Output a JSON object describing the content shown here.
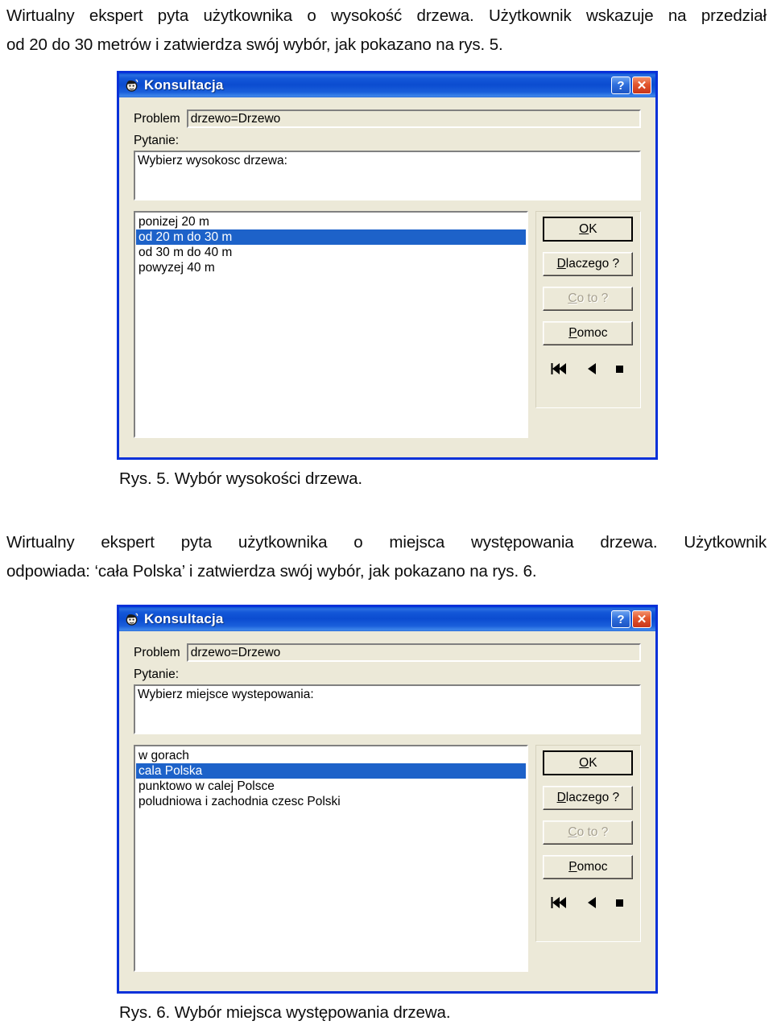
{
  "document": {
    "paragraph_1": "Wirtualny ekspert pyta użytkownika o wysokość drzewa. Użytkownik wskazuje na przedział od 20 do 30 metrów i zatwierdza swój wybór, jak pokazano na rys. 5.",
    "paragraph_1_line_1": "Wirtualny ekspert pyta użytkownika o wysokość drzewa. Użytkownik wskazuje na przedział",
    "paragraph_1_line_2": "od 20 do 30 metrów i zatwierdza swój wybór, jak pokazano na rys. 5.",
    "caption_1": "Rys. 5. Wybór wysokości drzewa.",
    "paragraph_2_line_1": "Wirtualny ekspert pyta użytkownika o miejsca występowania drzewa. Użytkownik",
    "paragraph_2_line_2": "odpowiada: ‘cała Polska’ i zatwierdza swój wybór, jak pokazano na rys. 6.",
    "caption_2": "Rys. 6. Wybór miejsca występowania drzewa."
  },
  "dialog_1": {
    "title": "Konsultacja",
    "icon": "expert-head-icon",
    "titlebar_buttons": {
      "help_label": "?",
      "help_name": "help-icon",
      "close_label": "✕",
      "close_name": "close-icon"
    },
    "problem": {
      "label": "Problem",
      "value": "drzewo=Drzewo"
    },
    "question": {
      "label": "Pytanie:",
      "text": "Wybierz wysokosc drzewa:"
    },
    "list": {
      "items": [
        {
          "label": "ponizej 20 m",
          "selected": false
        },
        {
          "label": "od 20 m do 30 m",
          "selected": true
        },
        {
          "label": "od 30 m do 40 m",
          "selected": false
        },
        {
          "label": "powyzej 40 m",
          "selected": false
        }
      ],
      "selected_value": "od 20 m do 30 m"
    },
    "buttons": [
      {
        "label": "OK",
        "accel": "O",
        "state": "default"
      },
      {
        "label": "Dlaczego ?",
        "accel": "D",
        "state": "enabled"
      },
      {
        "label": "Co to ?",
        "accel": "C",
        "state": "disabled"
      },
      {
        "label": "Pomoc",
        "accel": "P",
        "state": "enabled"
      }
    ],
    "nav_icons": [
      {
        "name": "rewind-to-start-icon",
        "glyph": "⏮"
      },
      {
        "name": "previous-icon",
        "glyph": "◀"
      },
      {
        "name": "stop-icon",
        "glyph": "■"
      }
    ]
  },
  "dialog_2": {
    "title": "Konsultacja",
    "icon": "expert-head-icon",
    "titlebar_buttons": {
      "help_label": "?",
      "help_name": "help-icon",
      "close_label": "✕",
      "close_name": "close-icon"
    },
    "problem": {
      "label": "Problem",
      "value": "drzewo=Drzewo"
    },
    "question": {
      "label": "Pytanie:",
      "text": "Wybierz miejsce wystepowania:"
    },
    "list": {
      "items": [
        {
          "label": "w gorach",
          "selected": false
        },
        {
          "label": "cala Polska",
          "selected": true
        },
        {
          "label": "punktowo w calej Polsce",
          "selected": false
        },
        {
          "label": "poludniowa i zachodnia czesc Polski",
          "selected": false
        }
      ],
      "selected_value": "cala Polska"
    },
    "buttons": [
      {
        "label": "OK",
        "accel": "O",
        "state": "default"
      },
      {
        "label": "Dlaczego ?",
        "accel": "D",
        "state": "enabled"
      },
      {
        "label": "Co to ?",
        "accel": "C",
        "state": "disabled"
      },
      {
        "label": "Pomoc",
        "accel": "P",
        "state": "enabled"
      }
    ],
    "nav_icons": [
      {
        "name": "rewind-to-start-icon",
        "glyph": "⏮"
      },
      {
        "name": "previous-icon",
        "glyph": "◀"
      },
      {
        "name": "stop-icon",
        "glyph": "■"
      }
    ]
  },
  "colors": {
    "titlebar_blue": "#0a52d6",
    "window_border": "#0831d9",
    "dialog_face": "#ece9d8",
    "selection_blue": "#1d62c9",
    "close_red": "#e2552c",
    "disabled_text": "#a7a190"
  }
}
